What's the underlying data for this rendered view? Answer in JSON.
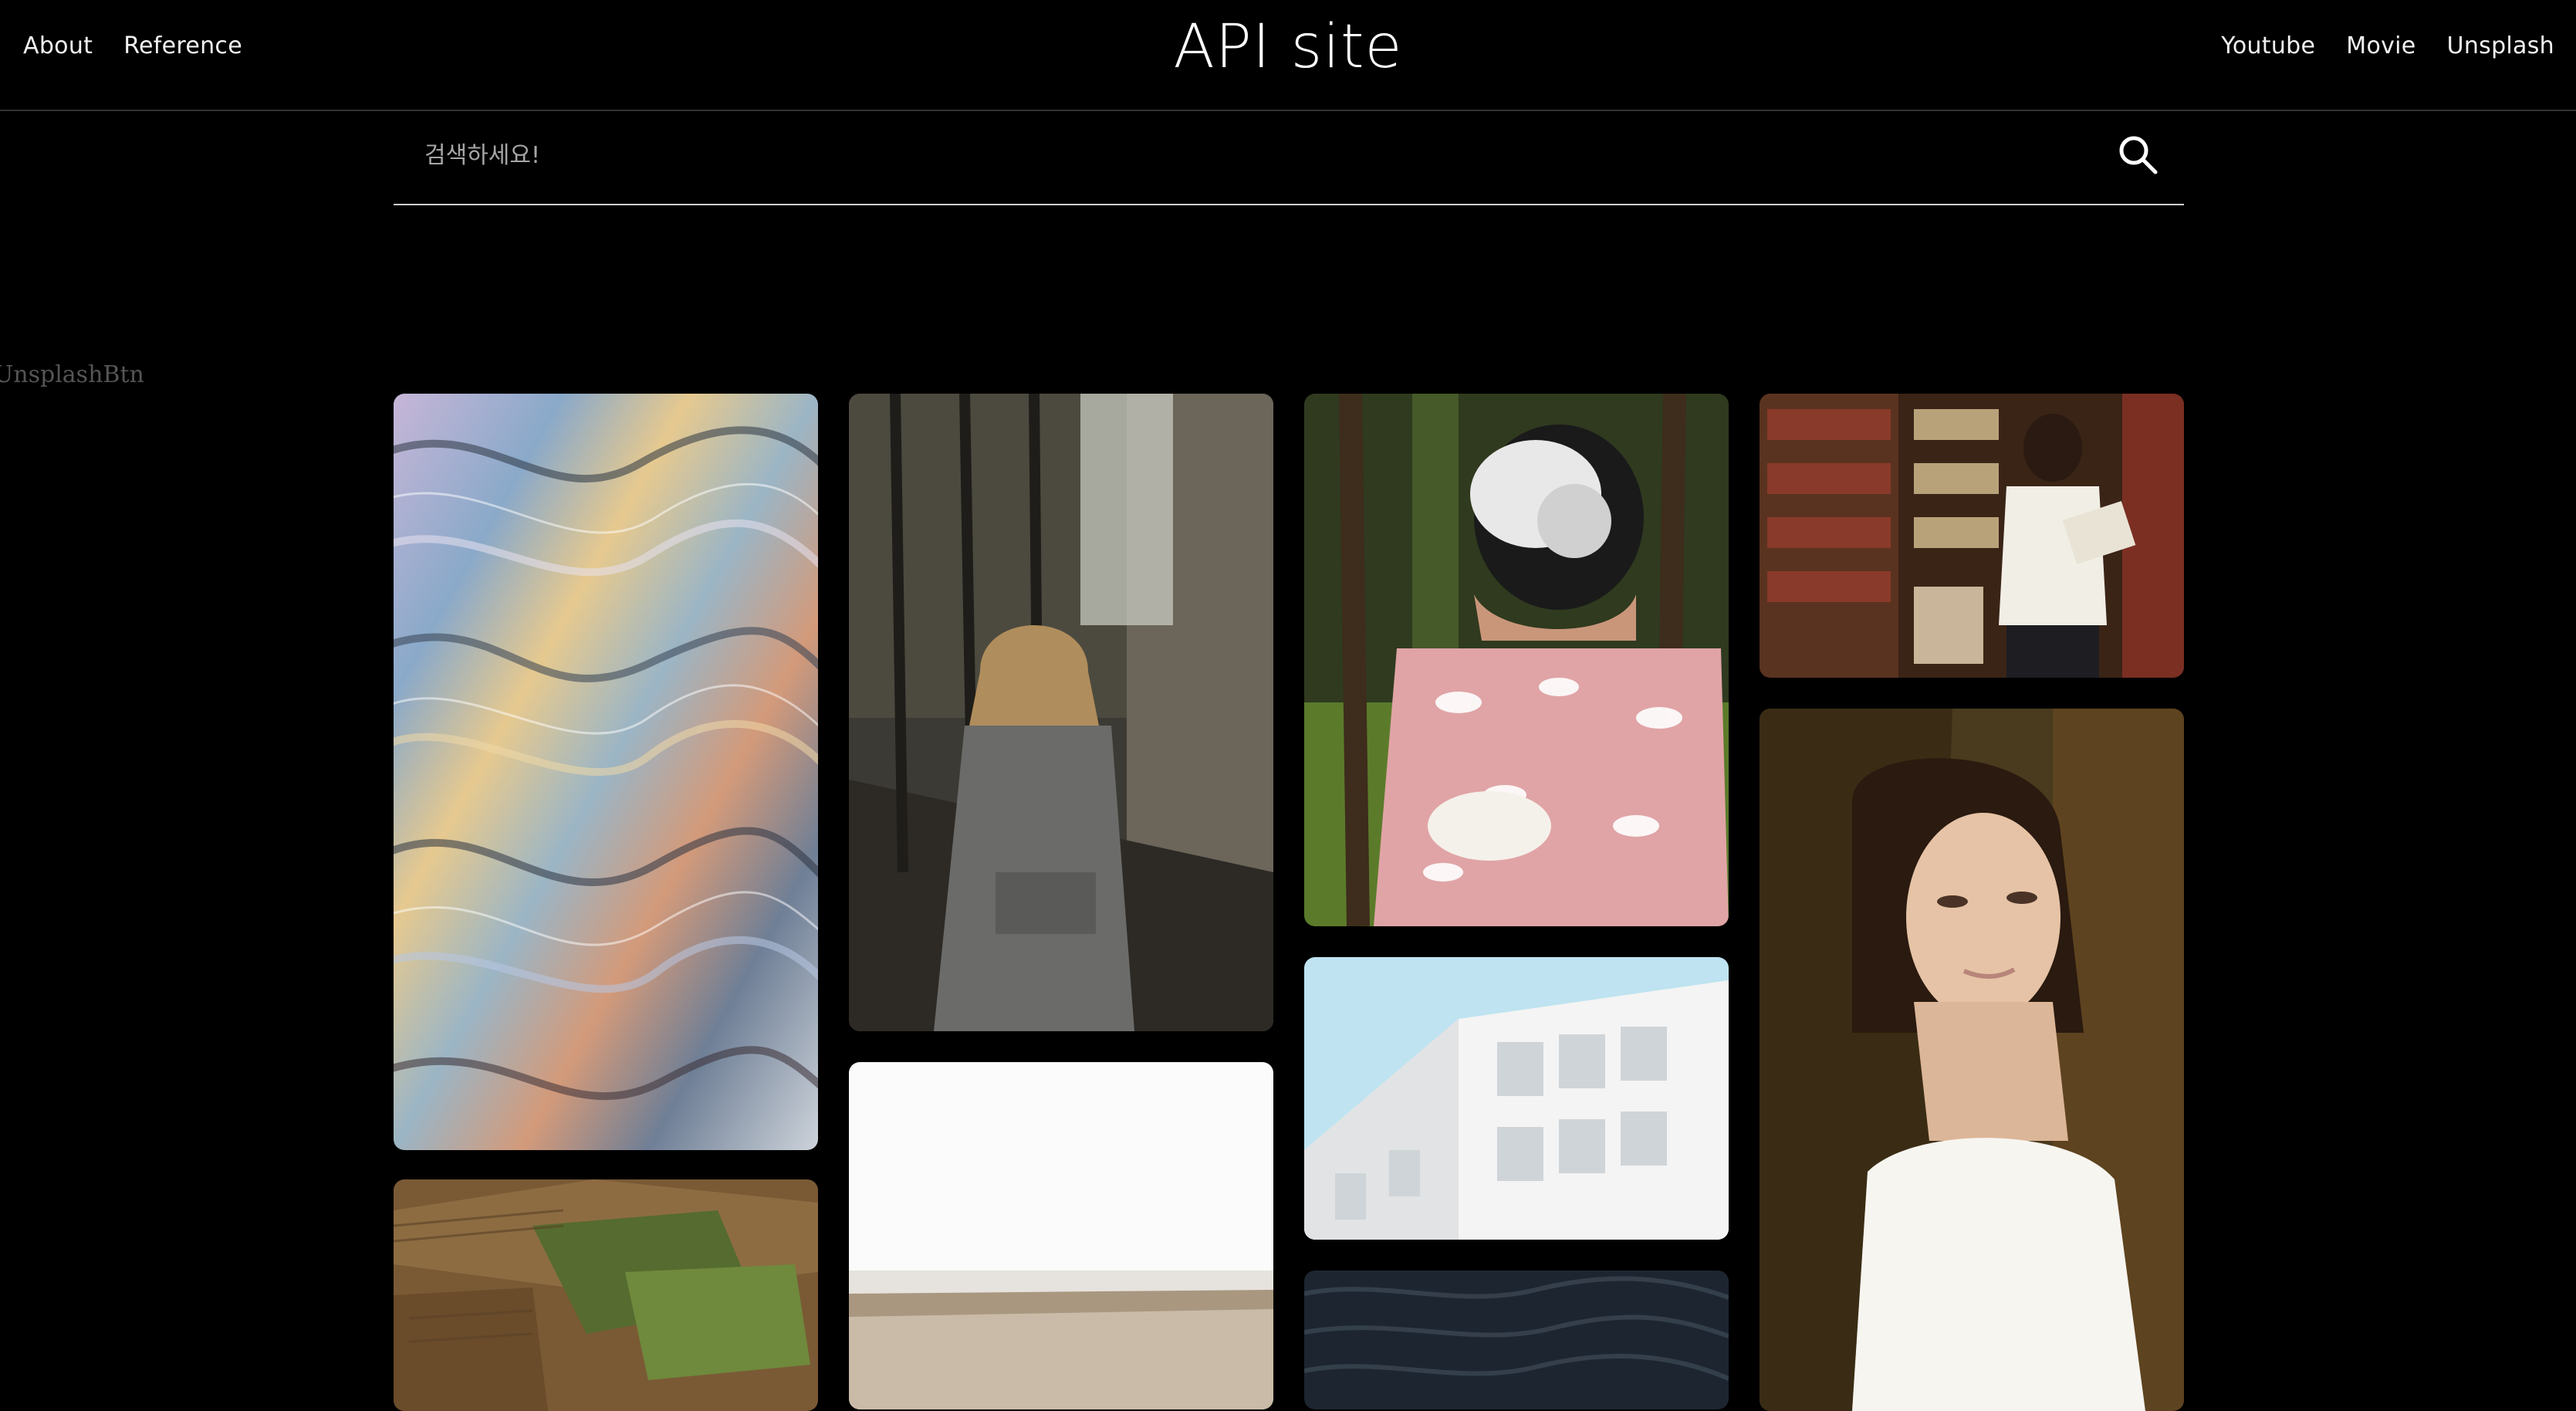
{
  "header": {
    "title": "API site",
    "nav_left": [
      "About",
      "Reference"
    ],
    "nav_right": [
      "Youtube",
      "Movie",
      "Unsplash"
    ]
  },
  "search": {
    "placeholder": "검색하세요!",
    "value": ""
  },
  "side_label": "UnsplashBtn",
  "gallery": {
    "photos": [
      {
        "id": "iridescent-liquid-metal",
        "alt": ""
      },
      {
        "id": "aerial-farmland",
        "alt": ""
      },
      {
        "id": "woman-in-gray-coat-walking",
        "alt": ""
      },
      {
        "id": "misty-field",
        "alt": ""
      },
      {
        "id": "woman-with-vr-headset",
        "alt": ""
      },
      {
        "id": "white-building",
        "alt": ""
      },
      {
        "id": "dark-water",
        "alt": ""
      },
      {
        "id": "woman-reading-in-bookstore",
        "alt": ""
      },
      {
        "id": "woman-portrait",
        "alt": ""
      }
    ]
  },
  "colors": {
    "background": "#000000",
    "text": "#ffffff",
    "placeholder": "#a6a6a6",
    "divider": "#333333"
  }
}
